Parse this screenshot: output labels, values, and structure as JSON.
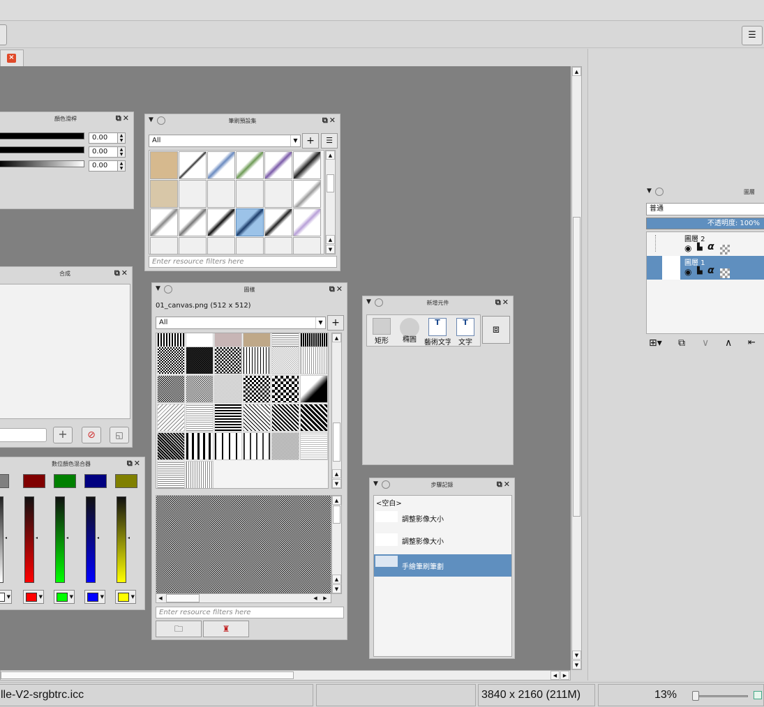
{
  "colors": {
    "accent": "#5f8fbf",
    "canvas_bg": "#808080",
    "close_tab": "#e04a2a"
  },
  "tab": {
    "close_icon": "close-icon"
  },
  "palette_docker": {
    "title": "顏色滑桿",
    "values": [
      "0.00",
      "0.00",
      "0.00"
    ]
  },
  "brush_docker": {
    "title": "筆刷預設集",
    "filter_value": "All",
    "filter_placeholder": "Enter resource filters here"
  },
  "compose_docker": {
    "title": "合成"
  },
  "mixer_docker": {
    "title": "數位顏色混合器",
    "swatches": [
      "#808080",
      "#800000",
      "#008000",
      "#000080",
      "#808000"
    ],
    "gradients": [
      "#ffffff",
      "#ff0000",
      "#00ff00",
      "#0000ff",
      "#ffff00"
    ],
    "selectors": [
      "#ffffff",
      "#ff0000",
      "#00ff00",
      "#0000ff",
      "#ffff00"
    ]
  },
  "pattern_docker": {
    "title": "圖樣",
    "filename": "01_canvas.png (512 x 512)",
    "filter_value": "All",
    "filter_placeholder": "Enter resource filters here"
  },
  "shapes_docker": {
    "title": "新增元件",
    "items": [
      "矩形",
      "橢圓",
      "藝術文字",
      "文字"
    ]
  },
  "history_docker": {
    "title": "步驟記錄",
    "items": [
      "<空白>",
      "調整影像大小",
      "調整影像大小",
      "手繪筆刷筆劃"
    ]
  },
  "layers_docker": {
    "title": "圖層",
    "blend_mode": "普通",
    "opacity": "不透明度:  100%",
    "layers": [
      "圖層 2",
      "圖層 1"
    ]
  },
  "status": {
    "profile": "lle-V2-srgbtrc.icc",
    "size": "3840 x 2160 (211M)",
    "zoom": "13%"
  }
}
